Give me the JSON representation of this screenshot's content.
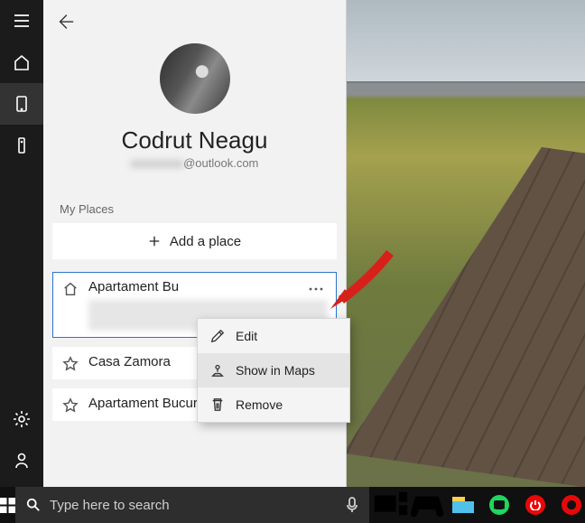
{
  "profile": {
    "name": "Codrut Neagu",
    "email_prefix_masked": "xxxxxxxxx",
    "email_domain": "@outlook.com"
  },
  "section_label": "My Places",
  "add_place_label": "Add a place",
  "places": [
    {
      "title": "Apartament Bu",
      "icon": "home",
      "selected": true,
      "address_masked": true
    },
    {
      "title": "Casa Zamora",
      "icon": "star",
      "selected": false,
      "address_masked": false
    },
    {
      "title": "Apartament Bucuresti",
      "icon": "star",
      "selected": false,
      "address_masked": false
    }
  ],
  "context_menu": {
    "items": [
      {
        "label": "Edit",
        "icon": "pencil"
      },
      {
        "label": "Show in Maps",
        "icon": "maps",
        "hover": true
      },
      {
        "label": "Remove",
        "icon": "trash"
      }
    ]
  },
  "nav_rail": {
    "top_icons": [
      "hamburger",
      "home",
      "phone",
      "remote"
    ],
    "active_icon": "phone",
    "bottom_icons": [
      "settings",
      "feedback"
    ]
  },
  "taskbar": {
    "search_placeholder": "Type here to search",
    "icons": [
      "taskview",
      "xbox",
      "explorer",
      "spotify",
      "power",
      "opera"
    ]
  }
}
